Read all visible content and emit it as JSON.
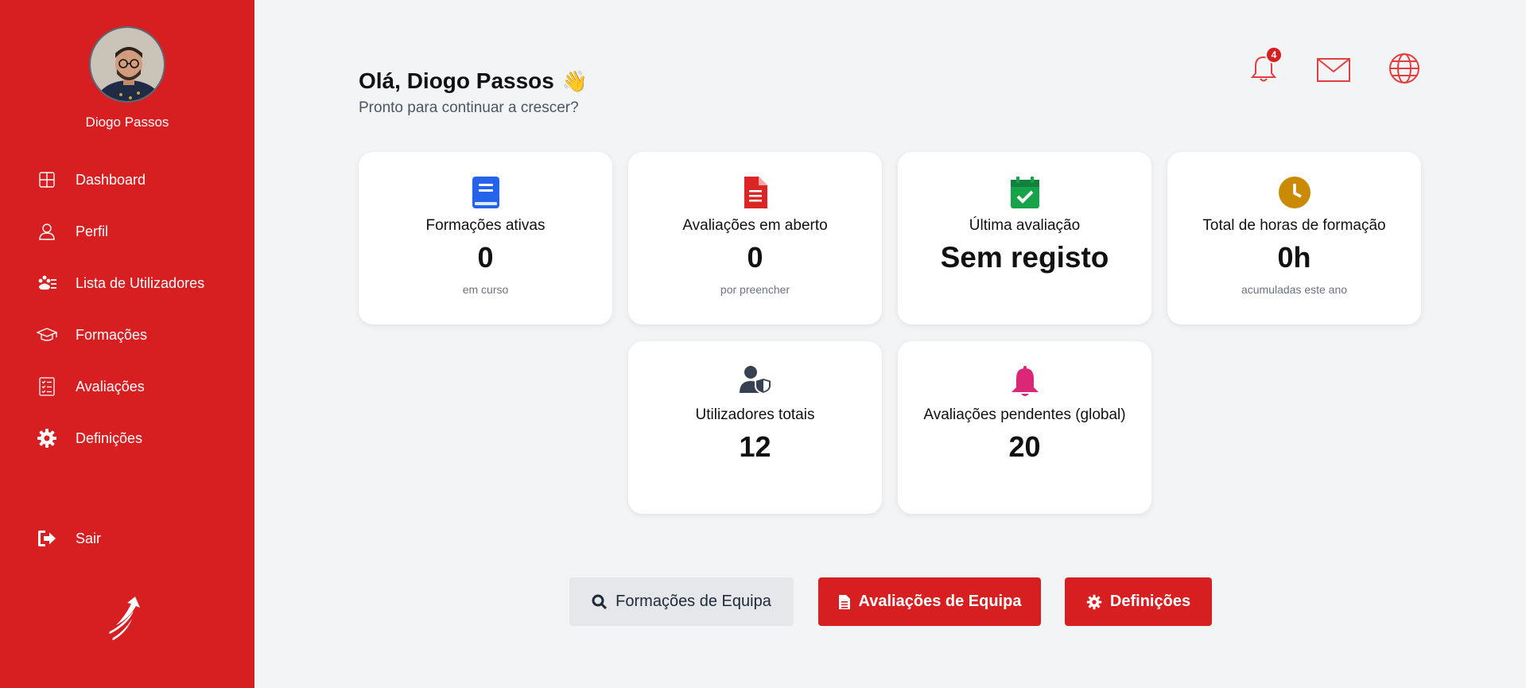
{
  "user": {
    "name": "Diogo Passos"
  },
  "sidebar": {
    "items": [
      {
        "label": "Dashboard",
        "icon": "grid-icon"
      },
      {
        "label": "Perfil",
        "icon": "user-icon"
      },
      {
        "label": "Lista de Utilizadores",
        "icon": "users-list-icon"
      },
      {
        "label": "Formações",
        "icon": "graduation-cap-icon"
      },
      {
        "label": "Avaliações",
        "icon": "checklist-icon"
      },
      {
        "label": "Definições",
        "icon": "gear-icon"
      }
    ],
    "logout_label": "Sair"
  },
  "header": {
    "greeting": "Olá, Diogo Passos",
    "wave": "👋",
    "subtitle": "Pronto para continuar a crescer?",
    "notification_count": "4"
  },
  "cards": [
    {
      "title": "Formações ativas",
      "value": "0",
      "sub": "em curso",
      "icon": "book-icon",
      "color": "#2563eb"
    },
    {
      "title": "Avaliações em aberto",
      "value": "0",
      "sub": "por preencher",
      "icon": "document-icon",
      "color": "#dc2626"
    },
    {
      "title": "Última avaliação",
      "value": "Sem registo",
      "sub": "",
      "icon": "calendar-check-icon",
      "color": "#16a34a"
    },
    {
      "title": "Total de horas de formação",
      "value": "0h",
      "sub": "acumuladas este ano",
      "icon": "clock-icon",
      "color": "#ca8a04"
    },
    {
      "title": "Utilizadores totais",
      "value": "12",
      "sub": "",
      "icon": "user-shield-icon",
      "color": "#374151"
    },
    {
      "title": "Avaliações pendentes (global)",
      "value": "20",
      "sub": "",
      "icon": "bell-icon",
      "color": "#db2777"
    }
  ],
  "actions": {
    "team_trainings": "Formações de Equipa",
    "team_evaluations": "Avaliações de Equipa",
    "settings": "Definições"
  },
  "colors": {
    "brand": "#d71f22",
    "background": "#f3f4f6"
  }
}
